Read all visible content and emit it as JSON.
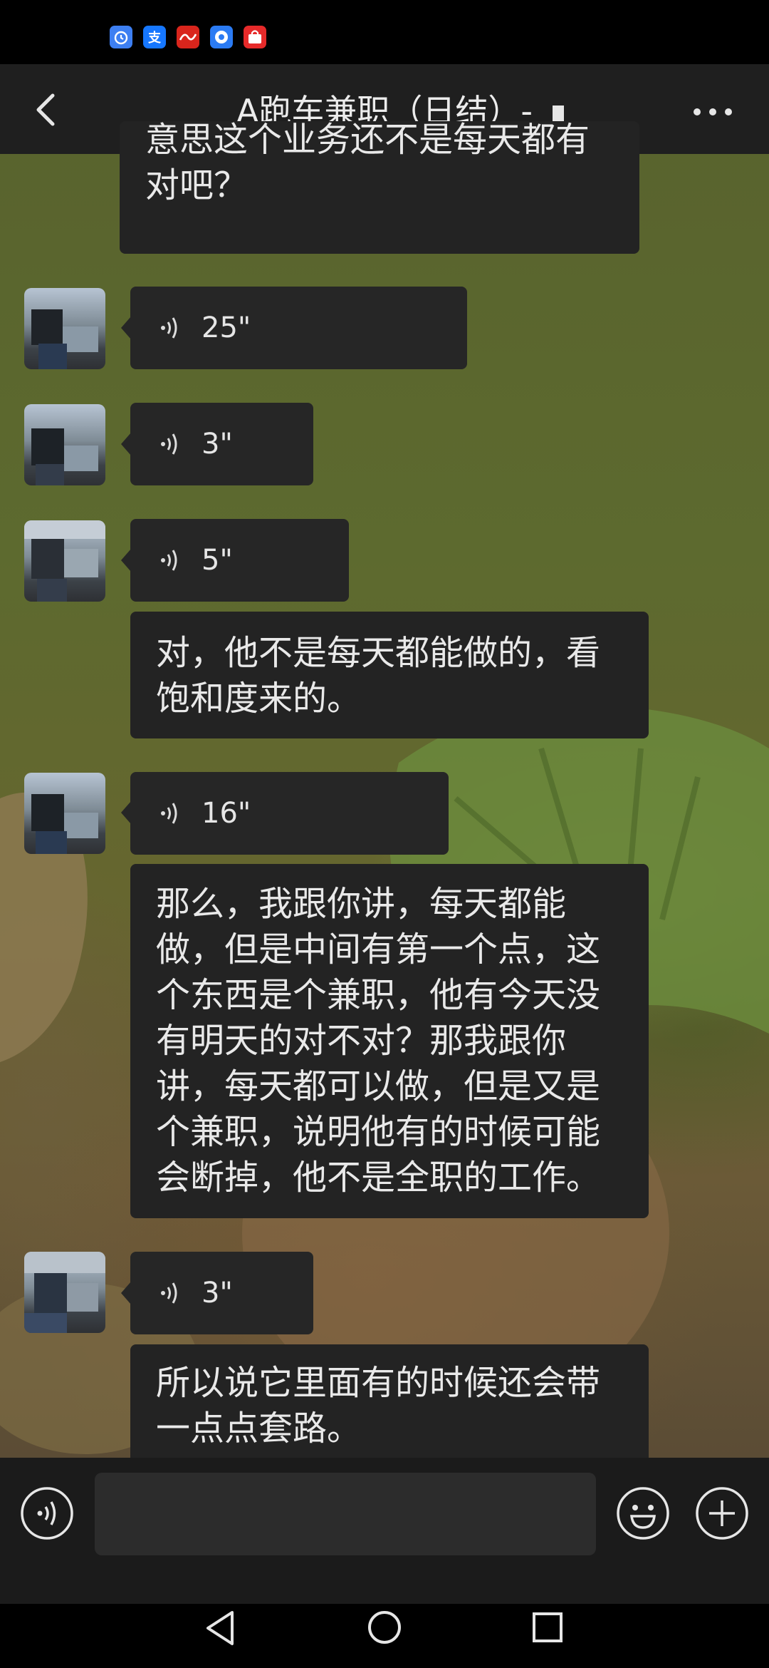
{
  "status_bar": {
    "app_icons": [
      {
        "icon": "alarm-clock-icon",
        "color": "#3d7ff2"
      },
      {
        "icon": "alipay-icon",
        "color": "#1677ff",
        "text": "支"
      },
      {
        "icon": "app-red-icon",
        "color": "#d9251c"
      },
      {
        "icon": "browser-icon",
        "color": "#2b7bf3"
      },
      {
        "icon": "shopping-icon",
        "color": "#e62a2a"
      }
    ]
  },
  "header": {
    "title": "A跑车兼职（日结）-",
    "back_icon": "chevron-left-icon",
    "more_icon": "more-dots-icon"
  },
  "messages": [
    {
      "type": "text",
      "side": "self",
      "lines": [
        "意思这个业务还不是每天都有",
        "对吧？"
      ]
    },
    {
      "type": "voice",
      "side": "other",
      "duration": "25\""
    },
    {
      "type": "voice",
      "side": "other",
      "duration": "3\""
    },
    {
      "type": "voice",
      "side": "other",
      "duration": "5\""
    },
    {
      "type": "text",
      "side": "other",
      "lines": [
        "对，他不是每天都能做的，看",
        "饱和度来的。"
      ]
    },
    {
      "type": "voice",
      "side": "other",
      "duration": "16\""
    },
    {
      "type": "text",
      "side": "other",
      "lines": [
        "那么，我跟你讲，每天都能",
        "做，但是中间有第一个点，这",
        "个东西是个兼职，他有今天没",
        "有明天的对不对？那我跟你",
        "讲，每天都可以做，但是又是",
        "个兼职，说明他有的时候可能",
        "会断掉，他不是全职的工作。"
      ]
    },
    {
      "type": "voice",
      "side": "other",
      "duration": "3\""
    },
    {
      "type": "text",
      "side": "other",
      "lines": [
        "所以说它里面有的时候还会带",
        "一点点套路。"
      ]
    }
  ],
  "input_bar": {
    "placeholder": "",
    "voice_icon": "voice-mode-icon",
    "emoji_icon": "emoji-icon",
    "plus_icon": "plus-circle-icon"
  },
  "colors": {
    "bubble": "#232323",
    "header": "#1f1f1f",
    "text": "#e9e9e9"
  }
}
